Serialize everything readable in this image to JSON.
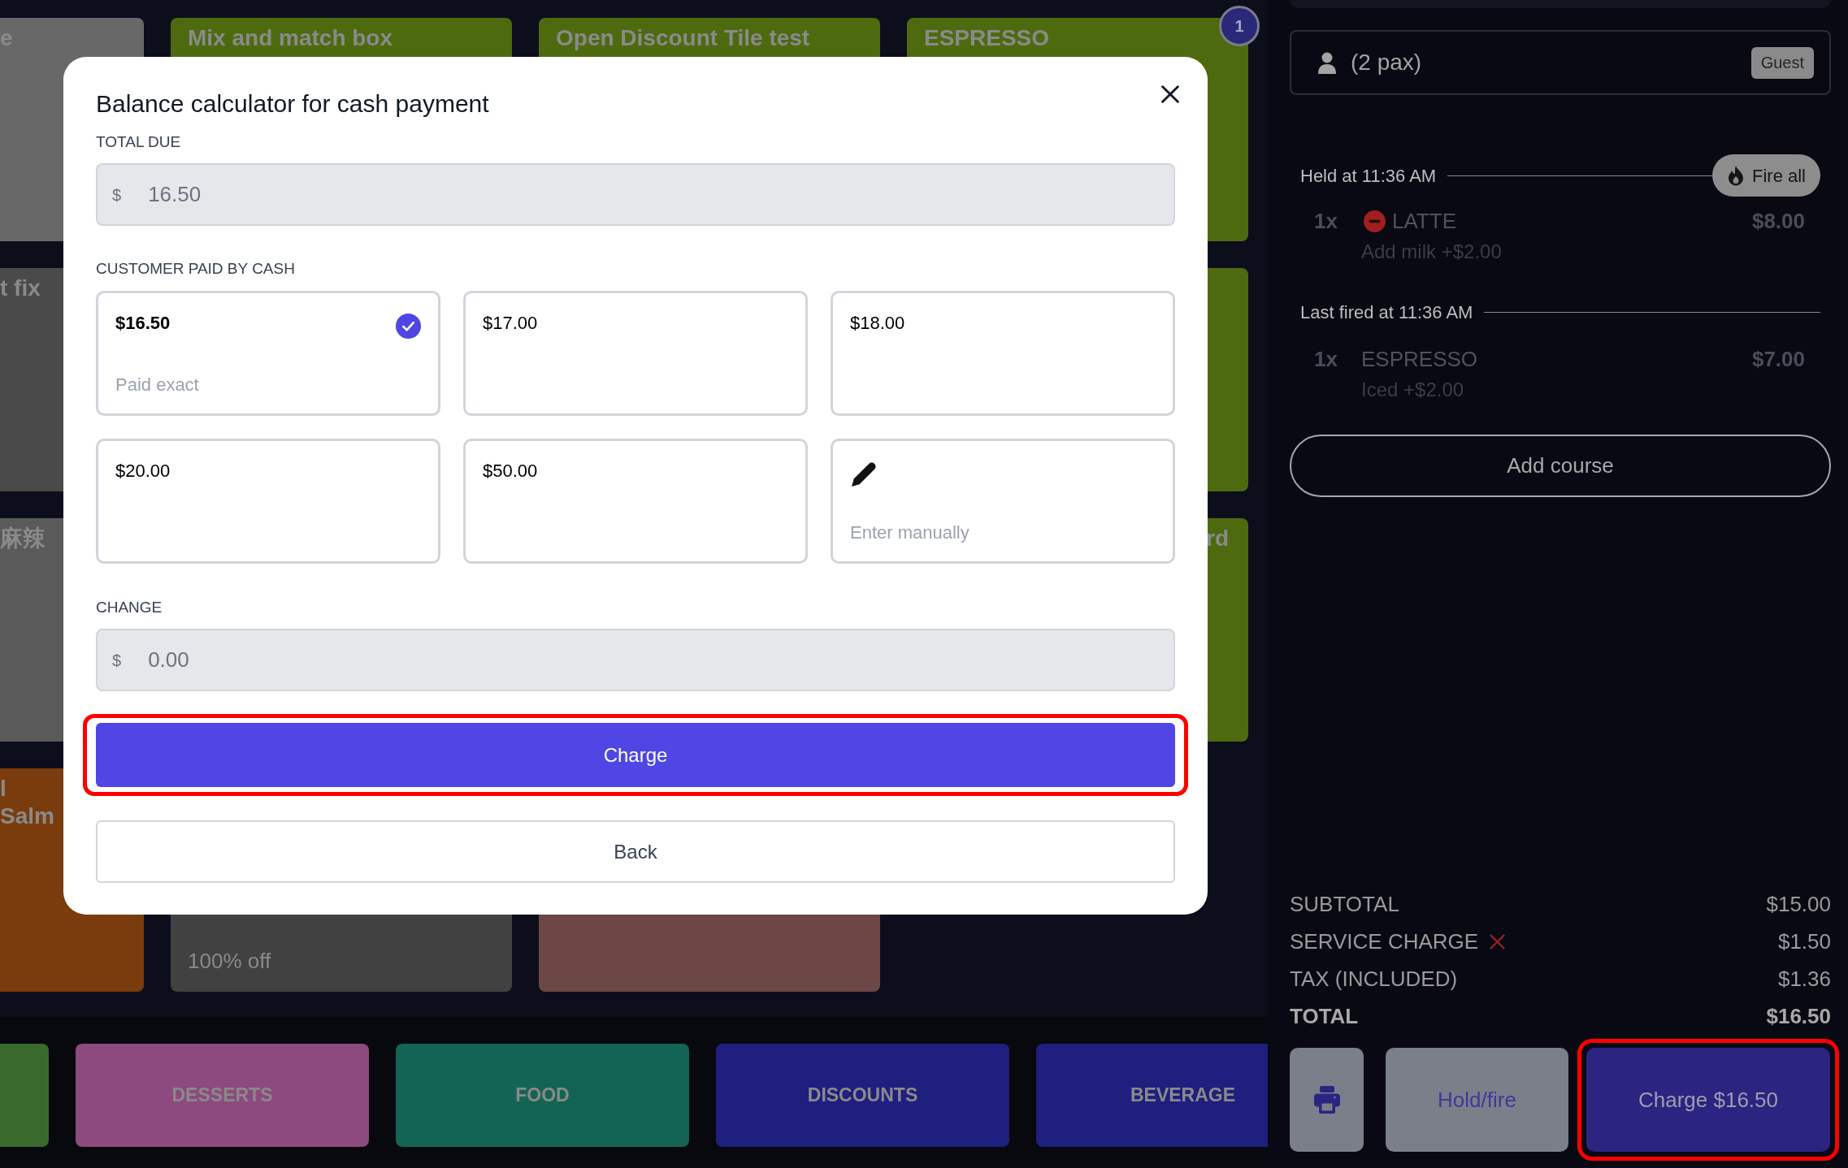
{
  "tile_rows": [
    {
      "tiles": [
        {
          "label": "e",
          "color": "#686868",
          "kind": "name"
        },
        {
          "label": "Mix and match box",
          "color": "#4e6a0f",
          "kind": "name"
        },
        {
          "label": "Open Discount Tile test",
          "color": "#4e6a0f",
          "kind": "name"
        },
        {
          "label": "ESPRESSO",
          "color": "#4e6a0f",
          "kind": "name"
        }
      ]
    },
    {
      "tiles": [
        {
          "label": "t fix",
          "color": "#4a4a4a",
          "kind": "name"
        },
        {
          "color": "#4e6a0f",
          "kind": "name"
        }
      ]
    },
    {
      "tiles": [
        {
          "label": "麻辣",
          "color": "#5a5a5a",
          "kind": "name"
        },
        {
          "label": "rd",
          "color": "#4e6a0f",
          "kind": "tail"
        }
      ]
    },
    {
      "tiles": [
        {
          "label": "l\nSalm",
          "color": "#7a3c0c",
          "kind": "name"
        },
        {
          "subtitle": "100% off",
          "color": "#414141",
          "kind": "name"
        },
        {
          "color": "#6d4646",
          "kind": "name"
        }
      ]
    }
  ],
  "cart_badge": "1",
  "categories": [
    {
      "color": "#3a6a2b"
    },
    {
      "label": "DESSERTS",
      "color": "#8c4a7e"
    },
    {
      "label": "FOOD",
      "color": "#136454"
    },
    {
      "label": "DISCOUNTS",
      "color": "#1e1f7e"
    },
    {
      "label": "BEVERAGE",
      "color": "#1e1f7e"
    }
  ],
  "dialog": {
    "title": "Balance calculator for cash payment",
    "total_due": {
      "label": "TOTAL DUE",
      "currency": "$",
      "value": "16.50",
      "disabled": true
    },
    "paid": {
      "label": "CUSTOMER PAID BY CASH",
      "options": [
        {
          "kind": "amount",
          "amount": "$16.50",
          "note": "Paid exact",
          "selected": true
        },
        {
          "kind": "amount",
          "amount": "$17.00",
          "selected": false
        },
        {
          "kind": "amount",
          "amount": "$18.00",
          "selected": false
        },
        {
          "kind": "amount",
          "amount": "$20.00",
          "selected": false
        },
        {
          "kind": "amount",
          "amount": "$50.00",
          "selected": false
        },
        {
          "kind": "manual",
          "label": "Enter manually",
          "selected": false
        }
      ]
    },
    "change": {
      "label": "CHANGE",
      "currency": "$",
      "value": "0.00",
      "disabled": true
    },
    "charge_button": {
      "label": "Charge",
      "highlighted": true
    },
    "back_button": "Back"
  },
  "order": {
    "customer": {
      "pax": "(2 pax)",
      "badge": "Guest"
    },
    "courses": [
      {
        "heading": "Held at 11:36 AM",
        "action": "Fire all",
        "items": [
          {
            "quantity": "1x",
            "name": "LATTE",
            "price": "$8.00",
            "modifier": "Add milk +$2.00",
            "flagged": true
          }
        ]
      },
      {
        "heading": "Last fired at 11:36 AM",
        "items": [
          {
            "quantity": "1x",
            "name": "ESPRESSO",
            "price": "$7.00",
            "modifier": "Iced +$2.00",
            "flagged": false
          }
        ]
      }
    ],
    "add_course": "Add course",
    "summary": [
      {
        "kind": "line",
        "label": "SUBTOTAL",
        "value": "$15.00",
        "removable": false
      },
      {
        "kind": "line",
        "label": "SERVICE CHARGE",
        "value": "$1.50",
        "removable": true
      },
      {
        "kind": "line",
        "label": "TAX (INCLUDED)",
        "value": "$1.36",
        "removable": false
      },
      {
        "kind": "total",
        "label": "TOTAL",
        "value": "$16.50",
        "removable": false
      }
    ],
    "hold_fire": "Hold/fire",
    "charge": {
      "label": "Charge $16.50",
      "highlighted": true
    }
  }
}
